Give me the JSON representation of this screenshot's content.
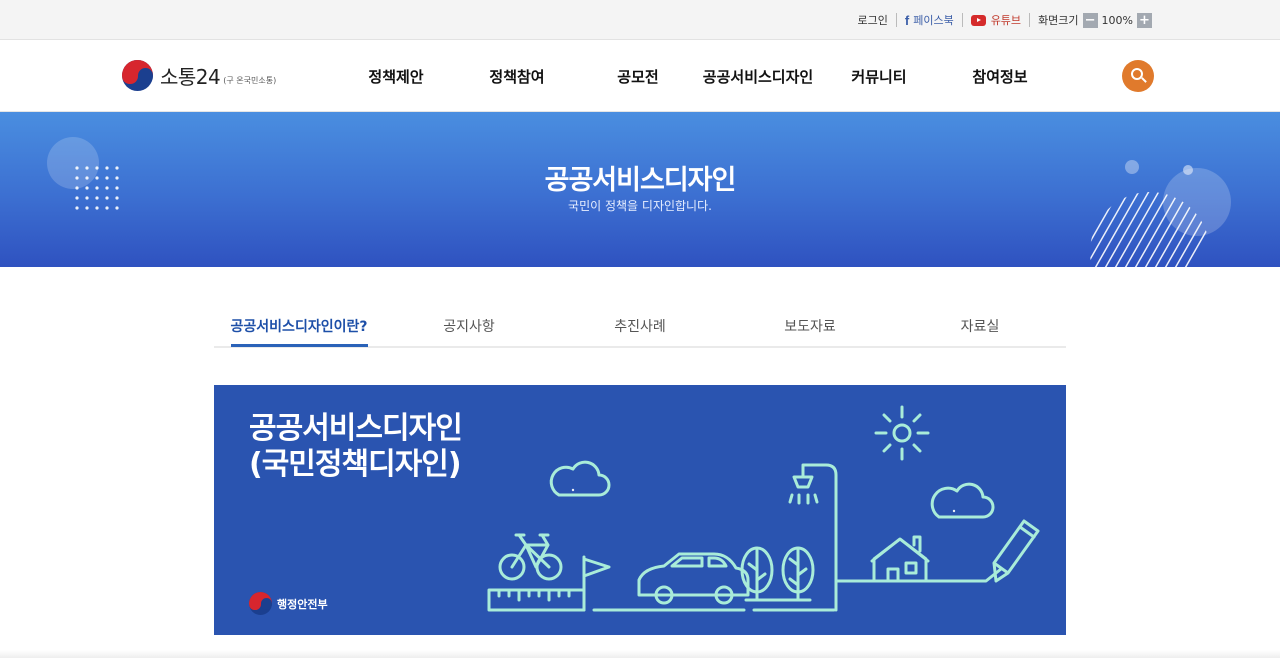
{
  "utility": {
    "login": "로그인",
    "facebook_icon": "f",
    "facebook": "페이스북",
    "youtube": "유튜브",
    "zoom_label": "화면크기",
    "zoom_minus": "−",
    "zoom_value": "100%",
    "zoom_plus": "+"
  },
  "header": {
    "logo_name": "소통24",
    "logo_sub": "(구 온국민소통)",
    "menu": [
      "정책제안",
      "정책참여",
      "공모전",
      "공공서비스디자인",
      "커뮤니티",
      "참여정보"
    ],
    "search_icon": "search-icon"
  },
  "hero": {
    "title": "공공서비스디자인",
    "subtitle": "국민이 정책을 디자인합니다."
  },
  "tabs": [
    "공공서비스디자인이란?",
    "공지사항",
    "추진사례",
    "보도자료",
    "자료실"
  ],
  "active_tab": 0,
  "banner": {
    "title_line1": "공공서비스디자인",
    "title_line2": "(국민정책디자인)",
    "ministry": "행정안전부"
  },
  "colors": {
    "accent": "#2a62b8",
    "search_button": "#e07a2c",
    "hero_top": "#4a8ee0",
    "hero_bottom": "#2f52c0",
    "banner_bg": "#2a54b0",
    "illustration_line": "#a9ecd9"
  }
}
